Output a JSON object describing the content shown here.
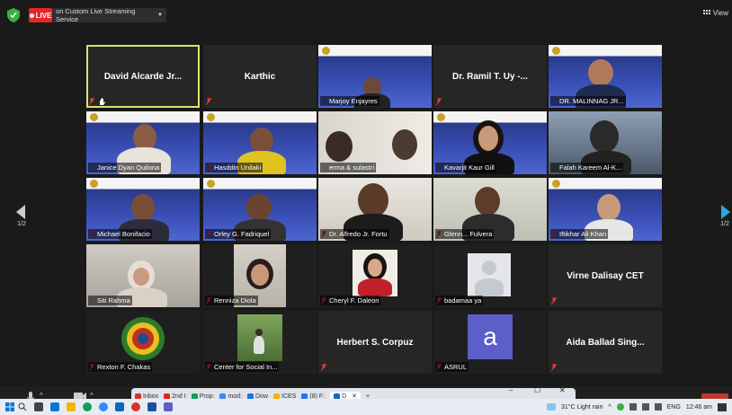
{
  "topbar": {
    "live_label": "LIVE",
    "stream_label": "on Custom Live Streaming Service",
    "view_label": "View"
  },
  "pager": {
    "left": "1/2",
    "right": "1/2"
  },
  "participants": [
    {
      "name": "David Alcarde Jr...",
      "video": false,
      "label_center": true
    },
    {
      "name": "Karthic",
      "video": false,
      "label_center": true
    },
    {
      "name": "Marjoy Enjayres",
      "video": true
    },
    {
      "name": "Dr. Ramil T. Uy -...",
      "video": false,
      "label_center": true
    },
    {
      "name": "DR. MALINNAG JR...",
      "video": true
    },
    {
      "name": "Janice Dyan Quilona",
      "video": true
    },
    {
      "name": "Hasddin Unilaki",
      "video": true
    },
    {
      "name": "erma & sulastri",
      "video": true
    },
    {
      "name": "Kavarjit Kaur Gill",
      "video": true
    },
    {
      "name": "Falah Kareem Al-K...",
      "video": true
    },
    {
      "name": "Michael Bonifacio",
      "video": true
    },
    {
      "name": "Orley G. Fadriquel",
      "video": true
    },
    {
      "name": "Dr. Alfredo Jr. Fortu",
      "video": true
    },
    {
      "name": "Glenn... Fulvera",
      "video": true
    },
    {
      "name": "Iftikhar Ali Khan",
      "video": true
    },
    {
      "name": "Siti Rahma",
      "video": true
    },
    {
      "name": "Renniza Diola",
      "video": true
    },
    {
      "name": "Cheryl F. Daleon",
      "video": true
    },
    {
      "name": "badamaa ya",
      "video": true
    },
    {
      "name": "Virne Dalisay CET",
      "video": false,
      "label_center": true
    },
    {
      "name": "Rexton F. Chakas",
      "video": true
    },
    {
      "name": "Center for Social In...",
      "video": true
    },
    {
      "name": "Herbert S. Corpuz",
      "video": false,
      "label_center": true
    },
    {
      "name": "ASRUL",
      "video": true
    },
    {
      "name": "Aida Ballad Sing...",
      "video": false,
      "label_center": true
    }
  ],
  "avatar_letter": "a",
  "window_controls": {
    "minimize": "–",
    "maximize": "☐",
    "close": "✕"
  },
  "browser_tabs": [
    "Inbox",
    "2nd I",
    "Prop:",
    "mod:",
    "Dow",
    "ICES",
    "(8) F:",
    "D"
  ],
  "new_tab": "+",
  "taskbar": {
    "weather": "31°C  Light rain",
    "lang": "ENG",
    "time": "12:46 am"
  },
  "colors": {
    "live": "#e02828",
    "active_speaker": "#d7e46a",
    "mic_muted": "#e03a3a",
    "avatar_bg": "#5b5fc7",
    "conference_blue": "#3a4fb5"
  }
}
